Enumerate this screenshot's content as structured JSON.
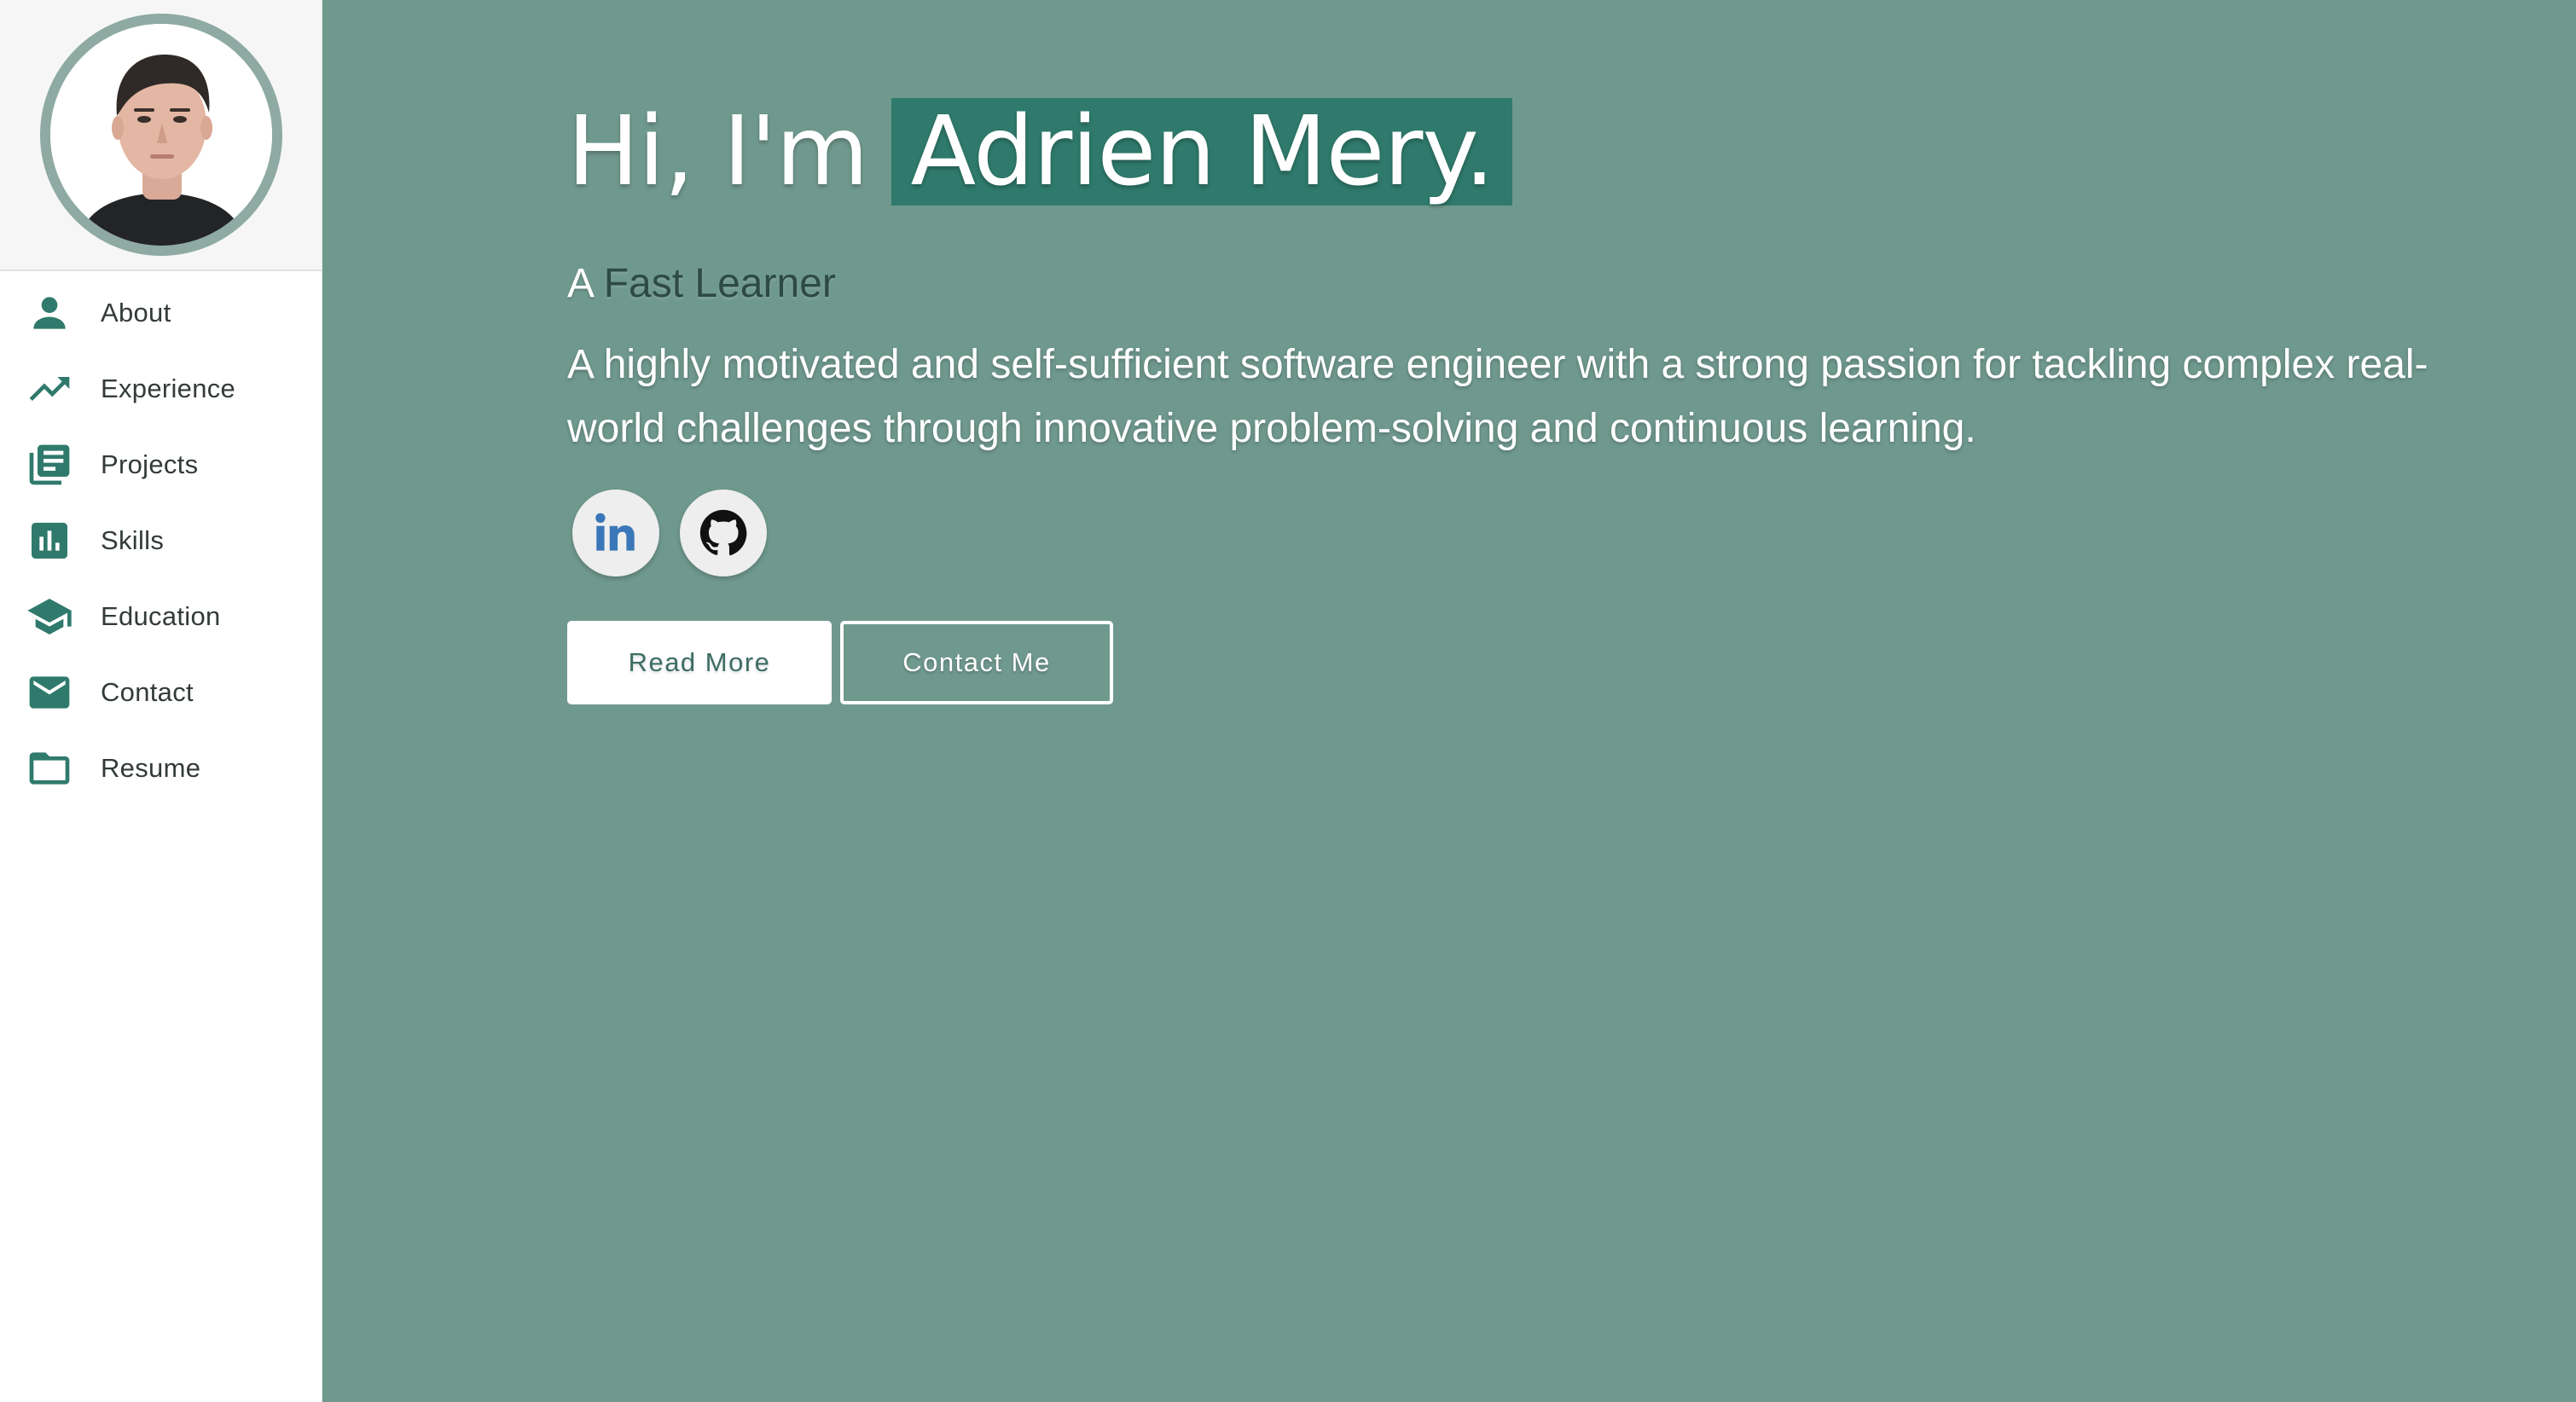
{
  "profile": {
    "avatar_alt": "profile photo"
  },
  "sidebar": {
    "items": [
      {
        "label": "About",
        "icon": "person-icon"
      },
      {
        "label": "Experience",
        "icon": "trending-up-icon"
      },
      {
        "label": "Projects",
        "icon": "library-books-icon"
      },
      {
        "label": "Skills",
        "icon": "bar-chart-icon"
      },
      {
        "label": "Education",
        "icon": "school-icon"
      },
      {
        "label": "Contact",
        "icon": "mail-icon"
      },
      {
        "label": "Resume",
        "icon": "folder-icon"
      }
    ]
  },
  "hero": {
    "greeting": "Hi, I'm",
    "name": "Adrien Mery.",
    "tagline_prefix": "A",
    "tagline_role": "Fast Learner",
    "bio": "A highly motivated and self-sufficient software engineer with a strong passion for tackling complex real-world challenges through innovative problem-solving and continuous learning.",
    "socials": [
      {
        "name": "LinkedIn",
        "icon": "linkedin-icon"
      },
      {
        "name": "GitHub",
        "icon": "github-icon"
      }
    ],
    "read_more_label": "Read More",
    "contact_label": "Contact Me"
  },
  "colors": {
    "accent": "#2f7a6c",
    "hero_background": "#70998e",
    "avatar_ring": "#8eaaa2"
  }
}
